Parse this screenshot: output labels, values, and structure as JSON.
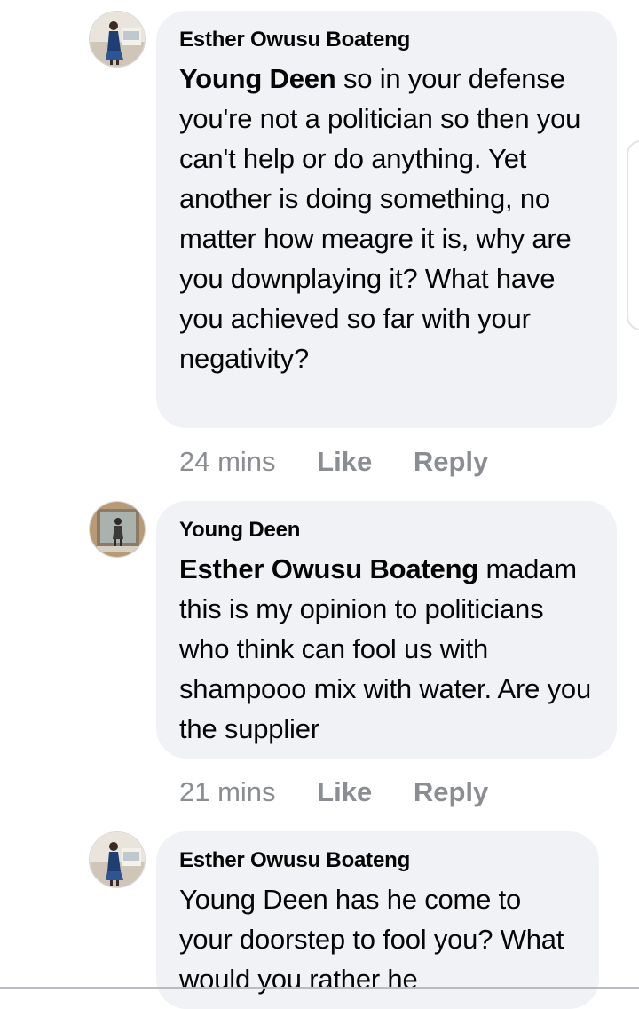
{
  "comments": [
    {
      "author": "Esther Owusu Boateng",
      "mention": "Young Deen",
      "text": " so in your defense you're not a politician so then you can't help or do anything. Yet another is doing something, no matter how meagre it is, why are you downplaying it? What have you achieved so far with your negativity?",
      "time": "24 mins",
      "like_label": "Like",
      "reply_label": "Reply",
      "avatar_icon": "profile-photo-woman"
    },
    {
      "author": "Young Deen",
      "mention": "Esther Owusu Boateng",
      "text": " madam this is my opinion to politicians who think can fool us with shampooo mix with water. Are you the supplier",
      "time": "21 mins",
      "like_label": "Like",
      "reply_label": "Reply",
      "avatar_icon": "profile-photo-man"
    },
    {
      "author": "Esther Owusu Boateng",
      "text": "Young Deen has he come to your doorstep to fool you? What would you rather he",
      "avatar_icon": "profile-photo-woman"
    }
  ],
  "colors": {
    "bubble": "#f0f2f5",
    "meta_text": "#8a8d91",
    "text": "#050505"
  }
}
